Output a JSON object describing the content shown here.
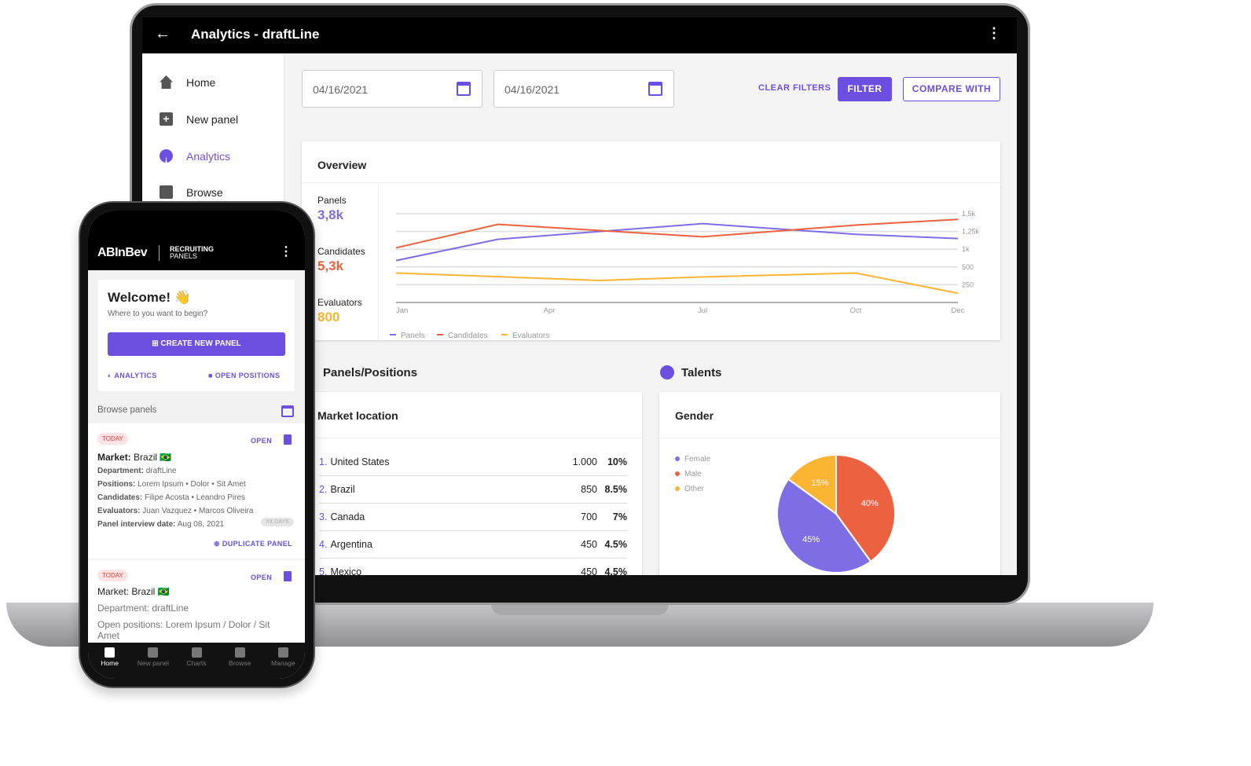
{
  "laptop": {
    "title": "Analytics - draftLine",
    "nav": [
      {
        "label": "Home",
        "icon": "home-icon"
      },
      {
        "label": "New panel",
        "icon": "add-box-icon"
      },
      {
        "label": "Analytics",
        "icon": "pie-chart-icon",
        "active": true
      },
      {
        "label": "Browse",
        "icon": "browse-icon"
      }
    ],
    "filters": {
      "date_from": "04/16/2021",
      "date_to": "04/16/2021",
      "clear": "CLEAR FILTERS",
      "filter": "FILTER",
      "compare": "COMPARE WITH"
    },
    "overview": {
      "title": "Overview",
      "stats": [
        {
          "label": "Panels",
          "value": "3,8k",
          "color": "#7e6ee6"
        },
        {
          "label": "Candidates",
          "value": "5,3k",
          "color": "#ec6240"
        },
        {
          "label": "Evaluators",
          "value": "800",
          "color": "#fbb532"
        }
      ]
    },
    "panels_positions": {
      "title": "Panels/Positions",
      "card_title": "Market location",
      "rows": [
        {
          "rank": "1.",
          "name": "United States",
          "value": "1.000",
          "pct": "10%"
        },
        {
          "rank": "2.",
          "name": "Brazil",
          "value": "850",
          "pct": "8.5%"
        },
        {
          "rank": "3.",
          "name": "Canada",
          "value": "700",
          "pct": "7%"
        },
        {
          "rank": "4.",
          "name": "Argentina",
          "value": "450",
          "pct": "4.5%"
        },
        {
          "rank": "5.",
          "name": "Mexico",
          "value": "450",
          "pct": "4.5%"
        }
      ]
    },
    "talents": {
      "title": "Talents",
      "card_title": "Gender"
    }
  },
  "chart_data": [
    {
      "type": "line",
      "x_ticks": [
        "Jan",
        "Apr",
        "Jul",
        "Oct",
        "Dec"
      ],
      "y_ticks": [
        "250",
        "500",
        "1k",
        "1,25k",
        "1,5k"
      ],
      "y_axis_side": "right",
      "grid": true,
      "legend": "bottom-left",
      "series": [
        {
          "name": "Panels",
          "color": "#7e6ee6",
          "points": [
            [
              "Jan",
              680
            ],
            [
              "Mar",
              1140
            ],
            [
              "Jul",
              1360
            ],
            [
              "Oct",
              1210
            ],
            [
              "Dec",
              1150
            ]
          ]
        },
        {
          "name": "Candidates",
          "color": "#ec6240",
          "points": [
            [
              "Jan",
              1020
            ],
            [
              "Mar",
              1350
            ],
            [
              "Jul",
              1175
            ],
            [
              "Oct",
              1340
            ],
            [
              "Dec",
              1420
            ]
          ]
        },
        {
          "name": "Evaluators",
          "color": "#fbb532",
          "points": [
            [
              "Jan",
              415
            ],
            [
              "May",
              310
            ],
            [
              "Jul",
              360
            ],
            [
              "Oct",
              415
            ],
            [
              "Dec",
              130
            ]
          ]
        }
      ]
    },
    {
      "type": "pie",
      "legend": "left",
      "slices": [
        {
          "name": "Female",
          "value": 45,
          "label": "45%",
          "color": "#7e6ee6"
        },
        {
          "name": "Male",
          "value": 40,
          "label": "40%",
          "color": "#ec6240"
        },
        {
          "name": "Other",
          "value": 15,
          "label": "15%",
          "color": "#fbb532"
        }
      ]
    }
  ],
  "phone": {
    "brand": "ABInBev",
    "app_line1": "RECRUITING",
    "app_line2": "PANELS",
    "welcome": "Welcome! 👋",
    "subtitle": "Where to you want to begin?",
    "create": "CREATE NEW PANEL",
    "analytics": "ANALYTICS",
    "open_positions": "OPEN POSITIONS",
    "browse": "Browse panels",
    "panel1": {
      "tag": "TODAY",
      "open": "OPEN",
      "market_label": "Market:",
      "market": "Brazil 🇧🇷",
      "fields": [
        {
          "k": "Department:",
          "v": "draftLine"
        },
        {
          "k": "Positions:",
          "v": "Lorem Ipsum • Dolor • Sit Amet"
        },
        {
          "k": "Candidates:",
          "v": "Filipe Acosta • Leandro Pires"
        },
        {
          "k": "Evaluators:",
          "v": "Juan Vazquez • Marcos Oliveira"
        },
        {
          "k": "Panel interview date:",
          "v": "Aug 08, 2021"
        }
      ],
      "days": "XX DAYS",
      "duplicate": "DUPLICATE PANEL"
    },
    "panel2": {
      "tag": "TODAY",
      "open": "OPEN",
      "market": "Market: Brazil 🇧🇷",
      "department": "Department: draftLine",
      "positions": "Open positions: Lorem Ipsum / Dolor / Sit Amet"
    },
    "bottom_nav": [
      {
        "label": "Home",
        "active": true
      },
      {
        "label": "New panel"
      },
      {
        "label": "Charts"
      },
      {
        "label": "Browse"
      },
      {
        "label": "Manage"
      }
    ]
  },
  "colors": {
    "accent": "#6c4fe0"
  }
}
